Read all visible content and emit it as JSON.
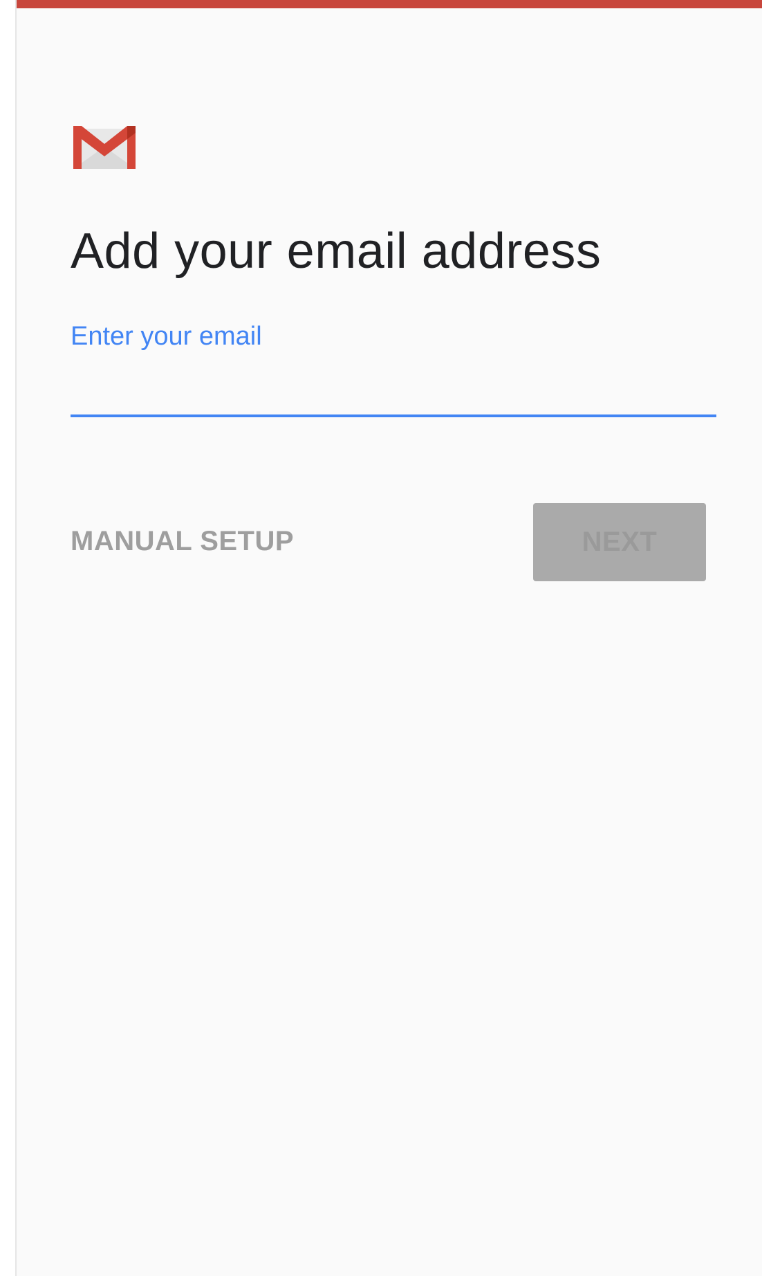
{
  "app": {
    "brand_color": "#c8463c",
    "logo_icon": "gmail-logo-icon"
  },
  "page": {
    "title": "Add your email address"
  },
  "email_field": {
    "label": "Enter your email",
    "value": "",
    "accent_color": "#4285f4"
  },
  "actions": {
    "manual_setup_label": "MANUAL SETUP",
    "next_label": "NEXT",
    "next_disabled": true
  }
}
